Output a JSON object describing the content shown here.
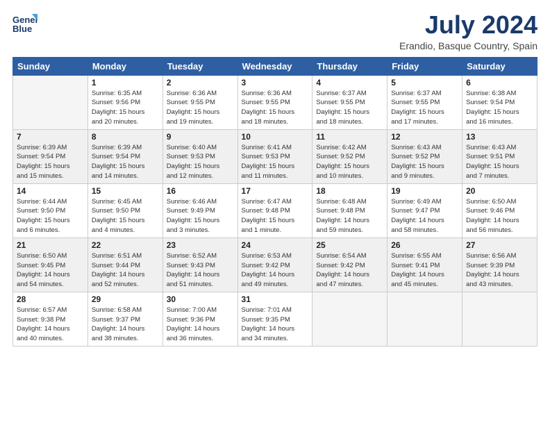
{
  "logo": {
    "line1": "General",
    "line2": "Blue"
  },
  "title": "July 2024",
  "location": "Erandio, Basque Country, Spain",
  "headers": [
    "Sunday",
    "Monday",
    "Tuesday",
    "Wednesday",
    "Thursday",
    "Friday",
    "Saturday"
  ],
  "weeks": [
    [
      {
        "day": "",
        "lines": []
      },
      {
        "day": "1",
        "lines": [
          "Sunrise: 6:35 AM",
          "Sunset: 9:56 PM",
          "Daylight: 15 hours",
          "and 20 minutes."
        ]
      },
      {
        "day": "2",
        "lines": [
          "Sunrise: 6:36 AM",
          "Sunset: 9:55 PM",
          "Daylight: 15 hours",
          "and 19 minutes."
        ]
      },
      {
        "day": "3",
        "lines": [
          "Sunrise: 6:36 AM",
          "Sunset: 9:55 PM",
          "Daylight: 15 hours",
          "and 18 minutes."
        ]
      },
      {
        "day": "4",
        "lines": [
          "Sunrise: 6:37 AM",
          "Sunset: 9:55 PM",
          "Daylight: 15 hours",
          "and 18 minutes."
        ]
      },
      {
        "day": "5",
        "lines": [
          "Sunrise: 6:37 AM",
          "Sunset: 9:55 PM",
          "Daylight: 15 hours",
          "and 17 minutes."
        ]
      },
      {
        "day": "6",
        "lines": [
          "Sunrise: 6:38 AM",
          "Sunset: 9:54 PM",
          "Daylight: 15 hours",
          "and 16 minutes."
        ]
      }
    ],
    [
      {
        "day": "7",
        "lines": [
          "Sunrise: 6:39 AM",
          "Sunset: 9:54 PM",
          "Daylight: 15 hours",
          "and 15 minutes."
        ]
      },
      {
        "day": "8",
        "lines": [
          "Sunrise: 6:39 AM",
          "Sunset: 9:54 PM",
          "Daylight: 15 hours",
          "and 14 minutes."
        ]
      },
      {
        "day": "9",
        "lines": [
          "Sunrise: 6:40 AM",
          "Sunset: 9:53 PM",
          "Daylight: 15 hours",
          "and 12 minutes."
        ]
      },
      {
        "day": "10",
        "lines": [
          "Sunrise: 6:41 AM",
          "Sunset: 9:53 PM",
          "Daylight: 15 hours",
          "and 11 minutes."
        ]
      },
      {
        "day": "11",
        "lines": [
          "Sunrise: 6:42 AM",
          "Sunset: 9:52 PM",
          "Daylight: 15 hours",
          "and 10 minutes."
        ]
      },
      {
        "day": "12",
        "lines": [
          "Sunrise: 6:43 AM",
          "Sunset: 9:52 PM",
          "Daylight: 15 hours",
          "and 9 minutes."
        ]
      },
      {
        "day": "13",
        "lines": [
          "Sunrise: 6:43 AM",
          "Sunset: 9:51 PM",
          "Daylight: 15 hours",
          "and 7 minutes."
        ]
      }
    ],
    [
      {
        "day": "14",
        "lines": [
          "Sunrise: 6:44 AM",
          "Sunset: 9:50 PM",
          "Daylight: 15 hours",
          "and 6 minutes."
        ]
      },
      {
        "day": "15",
        "lines": [
          "Sunrise: 6:45 AM",
          "Sunset: 9:50 PM",
          "Daylight: 15 hours",
          "and 4 minutes."
        ]
      },
      {
        "day": "16",
        "lines": [
          "Sunrise: 6:46 AM",
          "Sunset: 9:49 PM",
          "Daylight: 15 hours",
          "and 3 minutes."
        ]
      },
      {
        "day": "17",
        "lines": [
          "Sunrise: 6:47 AM",
          "Sunset: 9:48 PM",
          "Daylight: 15 hours",
          "and 1 minute."
        ]
      },
      {
        "day": "18",
        "lines": [
          "Sunrise: 6:48 AM",
          "Sunset: 9:48 PM",
          "Daylight: 14 hours",
          "and 59 minutes."
        ]
      },
      {
        "day": "19",
        "lines": [
          "Sunrise: 6:49 AM",
          "Sunset: 9:47 PM",
          "Daylight: 14 hours",
          "and 58 minutes."
        ]
      },
      {
        "day": "20",
        "lines": [
          "Sunrise: 6:50 AM",
          "Sunset: 9:46 PM",
          "Daylight: 14 hours",
          "and 56 minutes."
        ]
      }
    ],
    [
      {
        "day": "21",
        "lines": [
          "Sunrise: 6:50 AM",
          "Sunset: 9:45 PM",
          "Daylight: 14 hours",
          "and 54 minutes."
        ]
      },
      {
        "day": "22",
        "lines": [
          "Sunrise: 6:51 AM",
          "Sunset: 9:44 PM",
          "Daylight: 14 hours",
          "and 52 minutes."
        ]
      },
      {
        "day": "23",
        "lines": [
          "Sunrise: 6:52 AM",
          "Sunset: 9:43 PM",
          "Daylight: 14 hours",
          "and 51 minutes."
        ]
      },
      {
        "day": "24",
        "lines": [
          "Sunrise: 6:53 AM",
          "Sunset: 9:42 PM",
          "Daylight: 14 hours",
          "and 49 minutes."
        ]
      },
      {
        "day": "25",
        "lines": [
          "Sunrise: 6:54 AM",
          "Sunset: 9:42 PM",
          "Daylight: 14 hours",
          "and 47 minutes."
        ]
      },
      {
        "day": "26",
        "lines": [
          "Sunrise: 6:55 AM",
          "Sunset: 9:41 PM",
          "Daylight: 14 hours",
          "and 45 minutes."
        ]
      },
      {
        "day": "27",
        "lines": [
          "Sunrise: 6:56 AM",
          "Sunset: 9:39 PM",
          "Daylight: 14 hours",
          "and 43 minutes."
        ]
      }
    ],
    [
      {
        "day": "28",
        "lines": [
          "Sunrise: 6:57 AM",
          "Sunset: 9:38 PM",
          "Daylight: 14 hours",
          "and 40 minutes."
        ]
      },
      {
        "day": "29",
        "lines": [
          "Sunrise: 6:58 AM",
          "Sunset: 9:37 PM",
          "Daylight: 14 hours",
          "and 38 minutes."
        ]
      },
      {
        "day": "30",
        "lines": [
          "Sunrise: 7:00 AM",
          "Sunset: 9:36 PM",
          "Daylight: 14 hours",
          "and 36 minutes."
        ]
      },
      {
        "day": "31",
        "lines": [
          "Sunrise: 7:01 AM",
          "Sunset: 9:35 PM",
          "Daylight: 14 hours",
          "and 34 minutes."
        ]
      },
      {
        "day": "",
        "lines": []
      },
      {
        "day": "",
        "lines": []
      },
      {
        "day": "",
        "lines": []
      }
    ]
  ]
}
